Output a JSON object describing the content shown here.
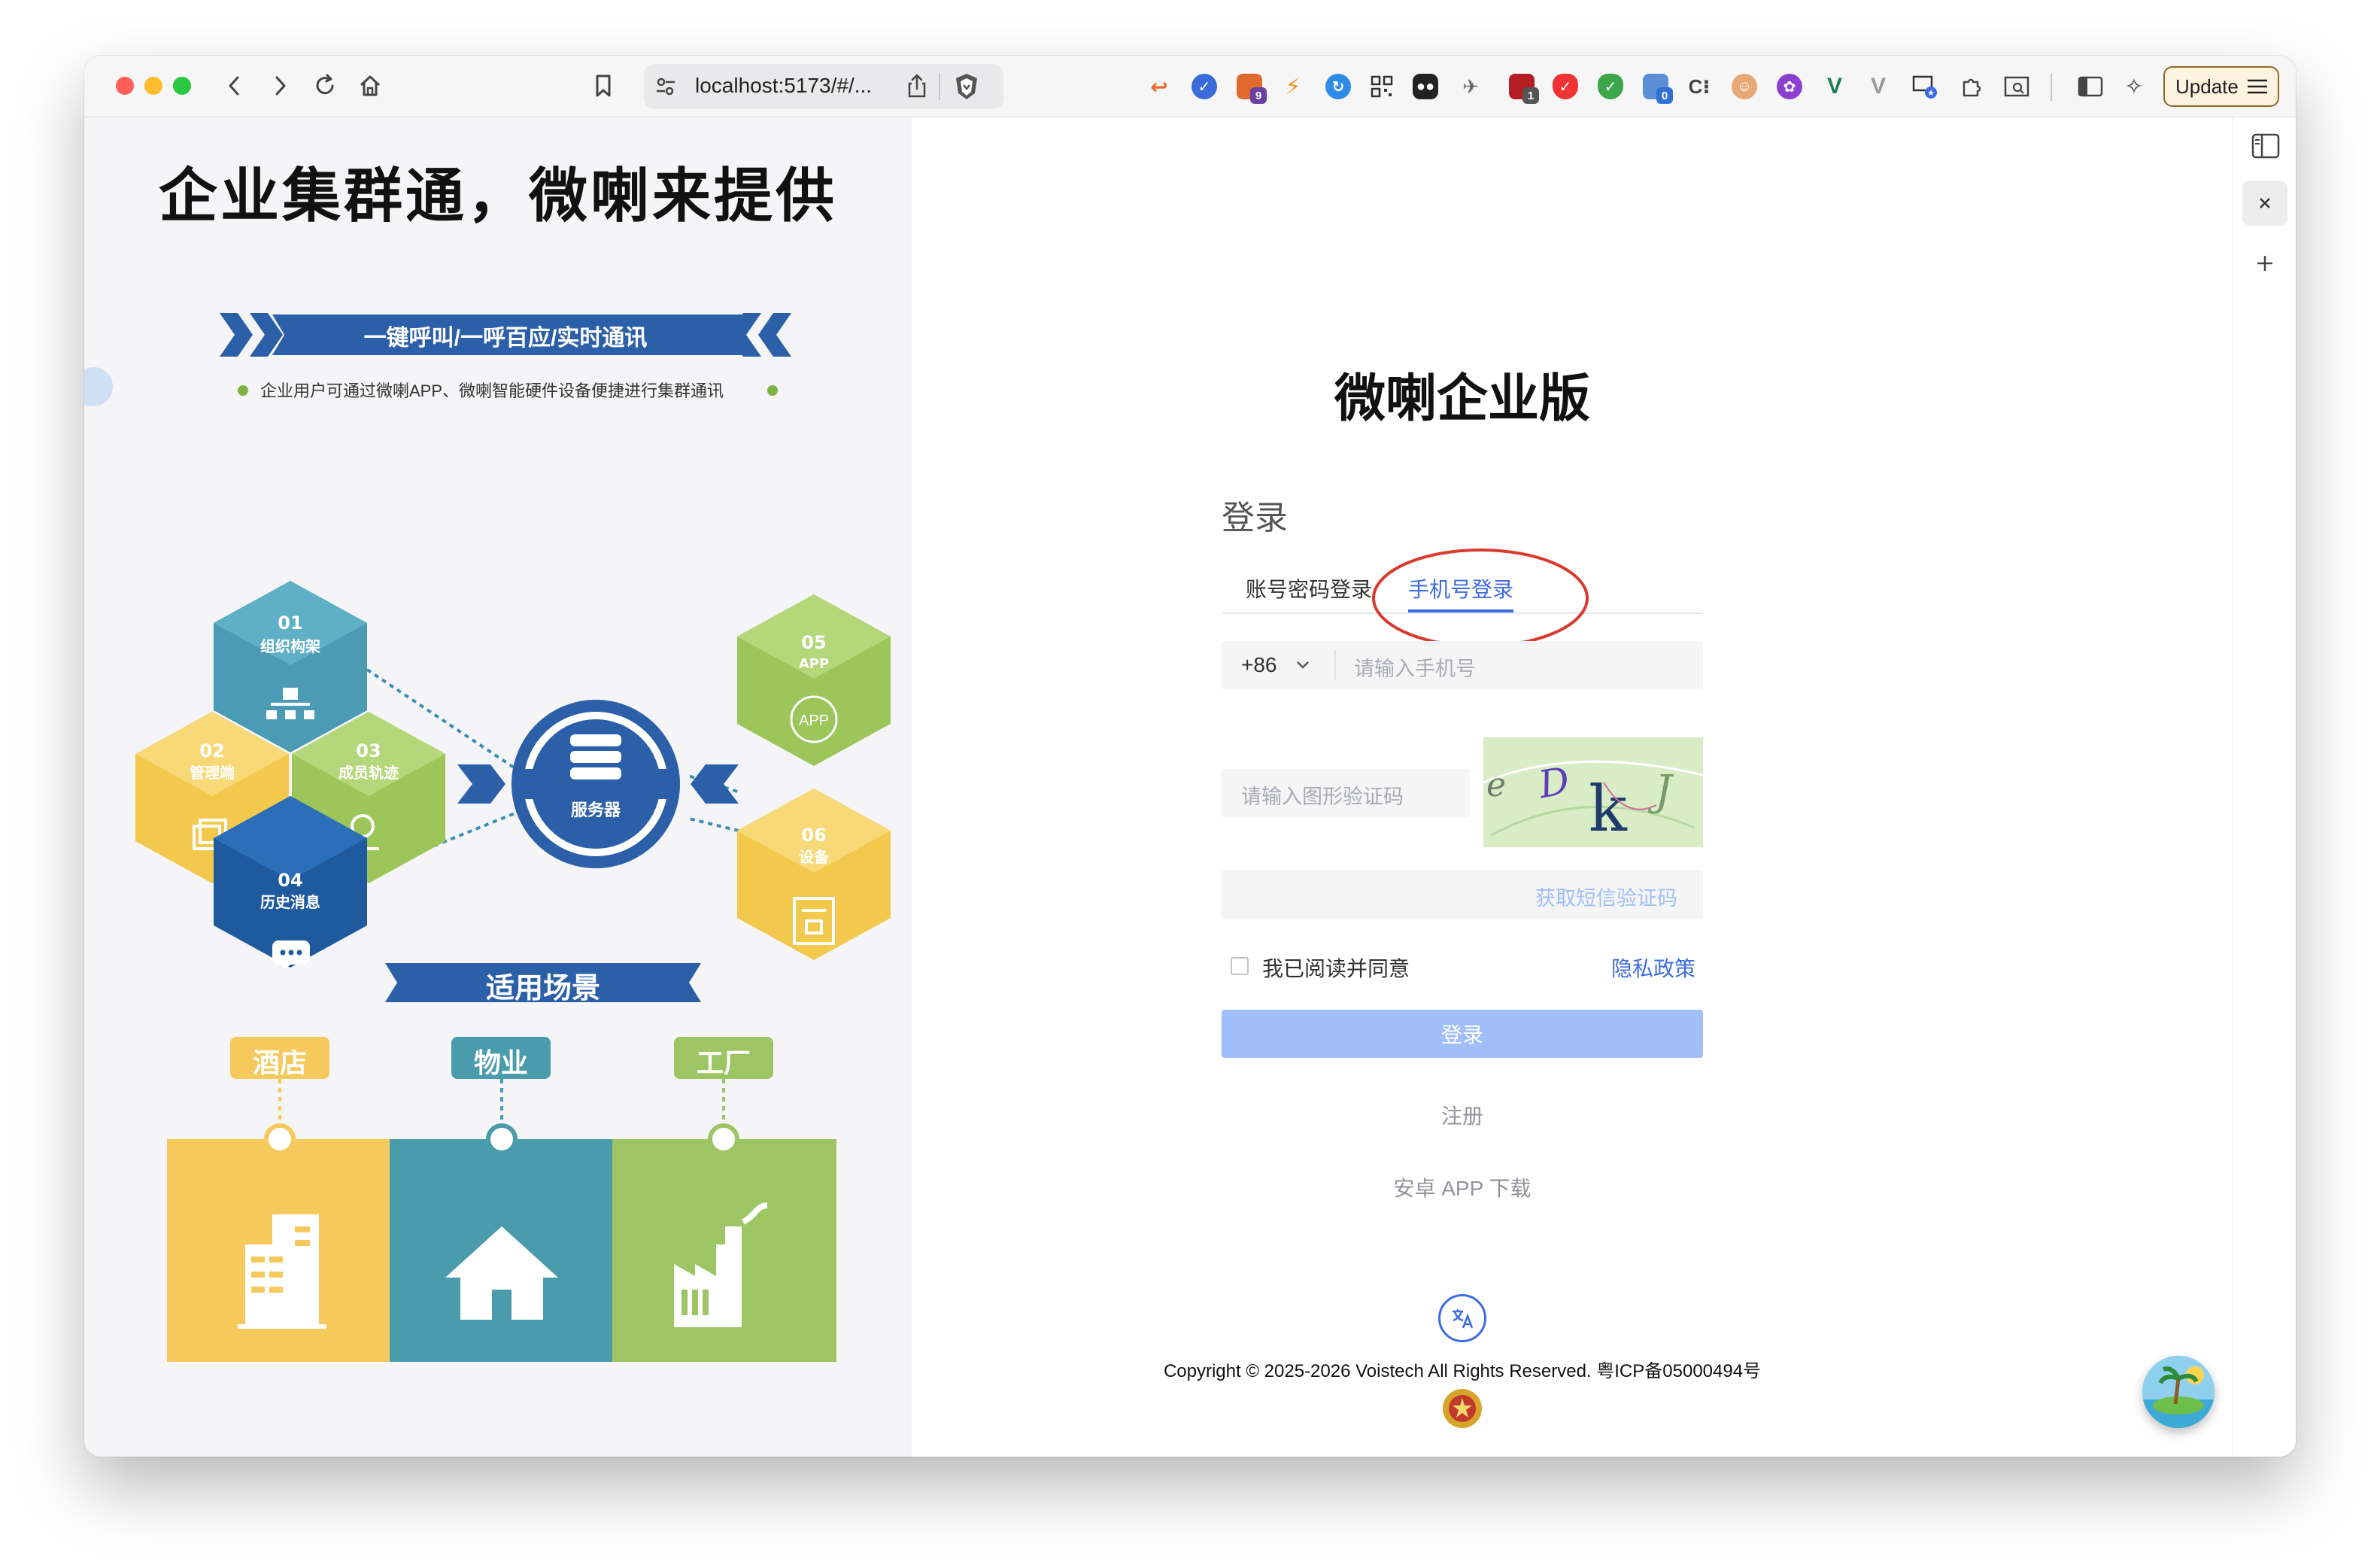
{
  "browser": {
    "url": "localhost:5173/#/...",
    "update_label": "Update",
    "extension_badges": {
      "ext3": "9",
      "ext11": "1",
      "ext15": "0"
    }
  },
  "promo": {
    "headline": "企业集群通，微喇来提供",
    "banner": "一键呼叫/一呼百应/实时通讯",
    "subline": "企业用户可通过微喇APP、微喇智能硬件设备便捷进行集群通讯",
    "hexes": [
      {
        "num": "01",
        "label": "组织构架",
        "icon": "org-chart-icon",
        "color": "#4a9bb3"
      },
      {
        "num": "02",
        "label": "管理端",
        "icon": "windows-icon",
        "color": "#f2c94c"
      },
      {
        "num": "03",
        "label": "成员轨迹",
        "icon": "location-pin-icon",
        "color": "#9cc65a"
      },
      {
        "num": "04",
        "label": "历史消息",
        "icon": "chat-bubble-icon",
        "color": "#1f5a9e"
      },
      {
        "num": "05",
        "label": "APP",
        "icon": "app-icon",
        "color": "#9cc65a"
      },
      {
        "num": "06",
        "label": "设备",
        "icon": "device-icon",
        "color": "#f2c94c"
      }
    ],
    "server_label": "服务器",
    "app_icon_text": "APP",
    "scenes_title": "适用场景",
    "scenes": [
      {
        "label": "酒店",
        "icon": "hotel-building-icon",
        "color": "#f5c95c"
      },
      {
        "label": "物业",
        "icon": "house-icon",
        "color": "#4a9bab"
      },
      {
        "label": "工厂",
        "icon": "factory-icon",
        "color": "#9ec563"
      }
    ]
  },
  "login": {
    "brand_title": "微喇企业版",
    "section_title": "登录",
    "tabs": [
      {
        "label": "账号密码登录",
        "active": false
      },
      {
        "label": "手机号登录",
        "active": true
      }
    ],
    "country_code": "+86",
    "phone_placeholder": "请输入手机号",
    "captcha_placeholder": "请输入图形验证码",
    "captcha_text": "eDkJ",
    "sms_button": "获取短信验证码",
    "agree_label": "我已阅读并同意",
    "privacy_link": "隐私政策",
    "login_button": "登录",
    "register_link": "注册",
    "android_download": "安卓 APP 下载",
    "copyright": "Copyright © 2025-2026 Voistech All Rights Reserved. 粤ICP备05000494号"
  },
  "colors": {
    "accent": "#3d6be0",
    "login_button_disabled": "#a0bff8",
    "annotation_circle": "#d83a2e",
    "hex_blue_dark": "#1f5a9e",
    "hex_teal": "#4a9bb3",
    "hex_yellow": "#f2c94c",
    "hex_green": "#9cc65a"
  }
}
